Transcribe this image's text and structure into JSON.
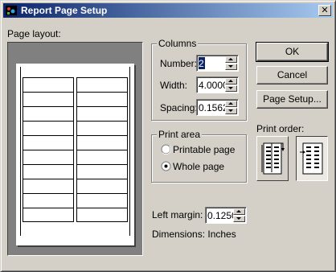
{
  "window": {
    "title": "Report Page Setup",
    "close_glyph": "✕"
  },
  "layout": {
    "label": "Page layout:"
  },
  "columns": {
    "title": "Columns",
    "number_label": "Number:",
    "number_value": "2",
    "width_label": "Width:",
    "width_value": "4.0000",
    "spacing_label": "Spacing:",
    "spacing_value": "0.1562"
  },
  "print_area": {
    "title": "Print area",
    "options": [
      {
        "label": "Printable page",
        "selected": false
      },
      {
        "label": "Whole page",
        "selected": true
      }
    ]
  },
  "left_margin": {
    "label": "Left margin:",
    "value": "0.1250"
  },
  "dimensions": {
    "text": "Dimensions: Inches"
  },
  "buttons": {
    "ok": "OK",
    "cancel": "Cancel",
    "page_setup": "Page Setup..."
  },
  "print_order": {
    "label": "Print order:",
    "options": [
      {
        "name": "down-then-across-icon",
        "selected": false
      },
      {
        "name": "across-then-down-icon",
        "selected": true
      }
    ]
  },
  "colors": {
    "titlebar_start": "#0a246a",
    "titlebar_end": "#a6caf0",
    "face": "#d4d0c8",
    "preview_bg": "#808080"
  }
}
